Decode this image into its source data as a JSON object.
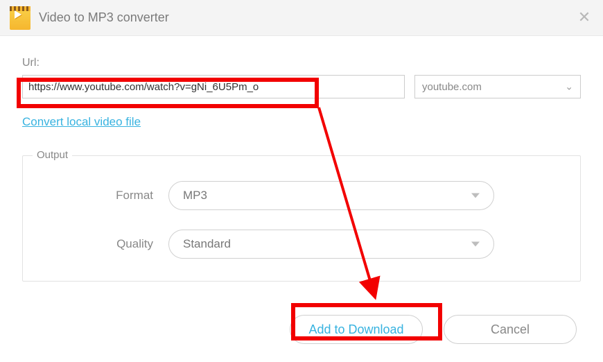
{
  "titlebar": {
    "title": "Video to MP3 converter"
  },
  "url_section": {
    "label": "Url:",
    "value": "https://www.youtube.com/watch?v=gNi_6U5Pm_o",
    "site_selected": "youtube.com"
  },
  "convert_link": "Convert local video file",
  "output": {
    "legend": "Output",
    "format_label": "Format",
    "format_value": "MP3",
    "quality_label": "Quality",
    "quality_value": "Standard"
  },
  "buttons": {
    "primary": "Add to Download",
    "cancel": "Cancel"
  }
}
